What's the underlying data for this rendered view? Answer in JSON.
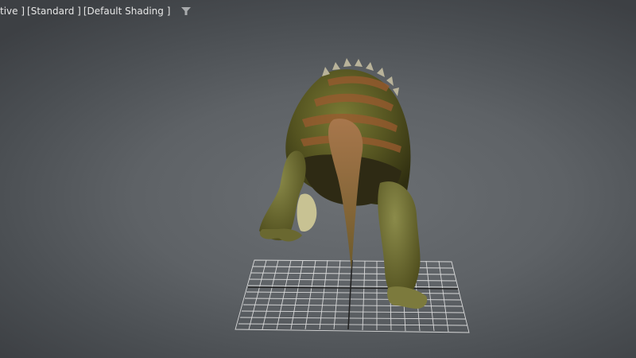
{
  "viewport": {
    "labels": [
      {
        "text": "tive ]"
      },
      {
        "text": "[Standard ]"
      },
      {
        "text": "[Default Shading ]"
      }
    ],
    "filter_icon": "filter-icon",
    "background_colors": [
      "#6b6f73",
      "#3d4044"
    ],
    "grid_color": "#e8e8e8",
    "model_colors": {
      "body": "#5b5a1f",
      "stripe": "#9a5a2f",
      "belly": "#2e2a14"
    }
  }
}
